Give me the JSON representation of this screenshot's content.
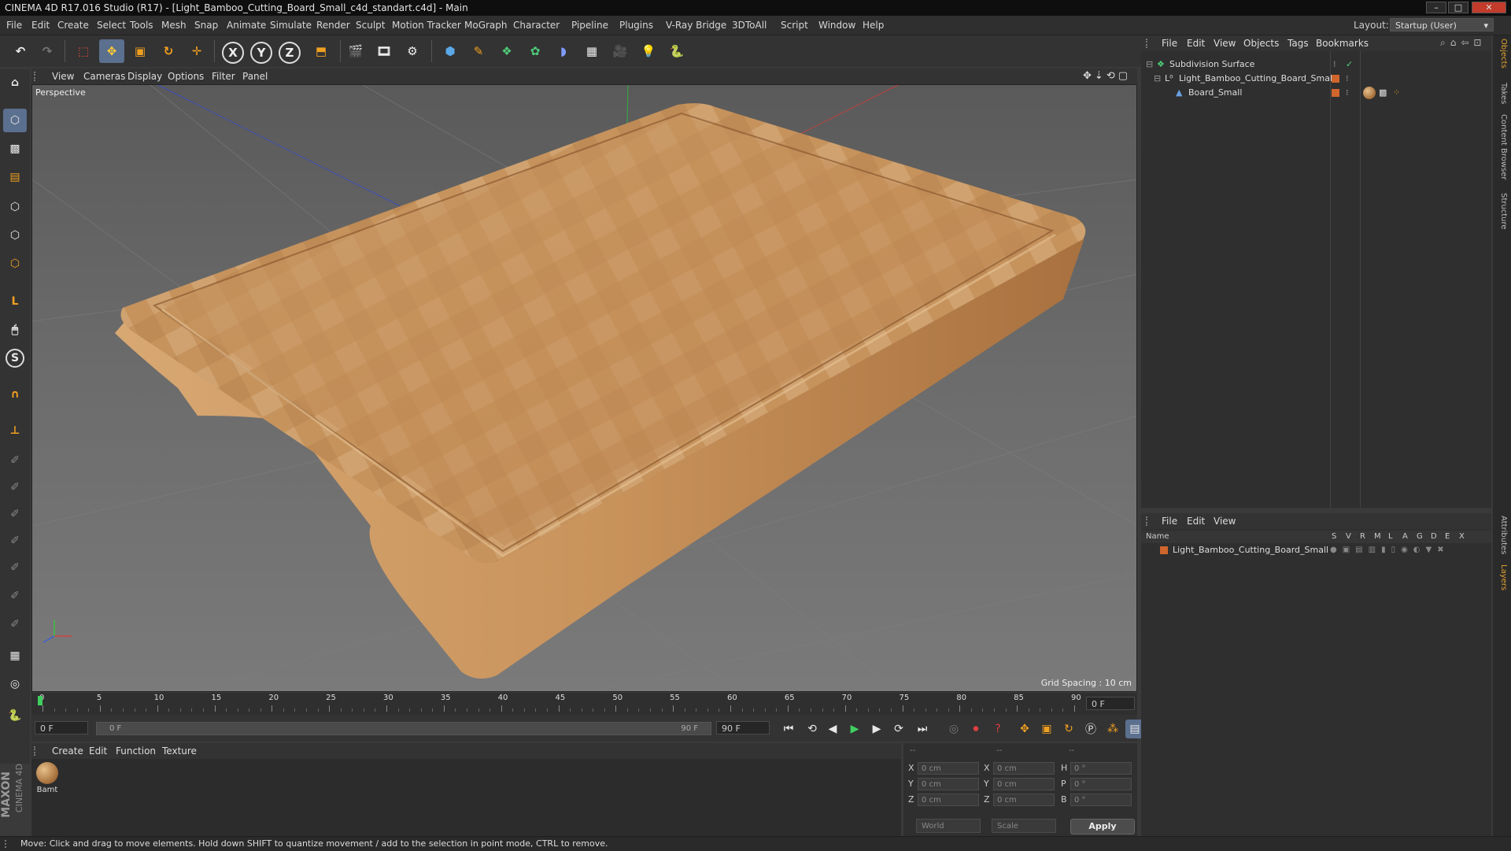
{
  "window": {
    "title": "CINEMA 4D R17.016 Studio (R17) - [Light_Bamboo_Cutting_Board_Small_c4d_standart.c4d] - Main",
    "controls": [
      "–",
      "□",
      "✕"
    ]
  },
  "menu": [
    "File",
    "Edit",
    "Create",
    "Select",
    "Tools",
    "Mesh",
    "Snap",
    "Animate",
    "Simulate",
    "Render",
    "Sculpt",
    "Motion Tracker",
    "MoGraph",
    "Character",
    "Pipeline",
    "Plugins",
    "V-Ray Bridge",
    "3DToAll",
    "Script",
    "Window",
    "Help"
  ],
  "layout": {
    "label": "Layout:",
    "value": "Startup (User)"
  },
  "toolbar": {
    "axis_x": "X",
    "axis_y": "Y",
    "axis_z": "Z"
  },
  "viewport": {
    "menu": [
      "View",
      "Cameras",
      "Display",
      "Options",
      "Filter",
      "Panel"
    ],
    "label": "Perspective",
    "grid_spacing": "Grid Spacing : 10 cm"
  },
  "timeline": {
    "ticks": [
      "0",
      "5",
      "10",
      "15",
      "20",
      "25",
      "30",
      "35",
      "40",
      "45",
      "50",
      "55",
      "60",
      "65",
      "70",
      "75",
      "80",
      "85",
      "90"
    ],
    "current_frame": "0 F",
    "start_field": "0 F",
    "range_start": "0 F",
    "range_end": "90 F",
    "end_field": "90 F"
  },
  "material": {
    "menu": [
      "Create",
      "Edit",
      "Function",
      "Texture"
    ],
    "items": [
      {
        "label": "Bamt"
      }
    ]
  },
  "coords": {
    "headers": [
      "--",
      "--",
      "--"
    ],
    "rows": [
      {
        "a": "X",
        "av": "0 cm",
        "b": "X",
        "bv": "0 cm",
        "c": "H",
        "cv": "0 °"
      },
      {
        "a": "Y",
        "av": "0 cm",
        "b": "Y",
        "bv": "0 cm",
        "c": "P",
        "cv": "0 °"
      },
      {
        "a": "Z",
        "av": "0 cm",
        "b": "Z",
        "bv": "0 cm",
        "c": "B",
        "cv": "0 °"
      }
    ],
    "mode": "World",
    "type": "Scale",
    "apply": "Apply"
  },
  "objects": {
    "menu": [
      "File",
      "Edit",
      "View",
      "Objects",
      "Tags",
      "Bookmarks"
    ],
    "rows": [
      {
        "name": "Subdivision Surface"
      },
      {
        "name": "Light_Bamboo_Cutting_Board_Small"
      },
      {
        "name": "Board_Small"
      }
    ]
  },
  "layers": {
    "menu": [
      "File",
      "Edit",
      "View"
    ],
    "header": {
      "name": "Name",
      "cols": [
        "S",
        "V",
        "R",
        "M",
        "L",
        "A",
        "G",
        "D",
        "E",
        "X"
      ]
    },
    "rows": [
      {
        "name": "Light_Bamboo_Cutting_Board_Small"
      }
    ]
  },
  "side_tabs": [
    "Objects",
    "Takes",
    "Content Browser",
    "Structure",
    "Attributes",
    "Layers"
  ],
  "status": "Move: Click and drag to move elements. Hold down SHIFT to quantize movement / add to the selection in point mode, CTRL to remove.",
  "brand": {
    "maxon": "MAXON",
    "product": "CINEMA 4D"
  },
  "colors": {
    "accent": "#5b6f8f",
    "object_orange": "#d0662c",
    "wood": "#c9955c"
  }
}
